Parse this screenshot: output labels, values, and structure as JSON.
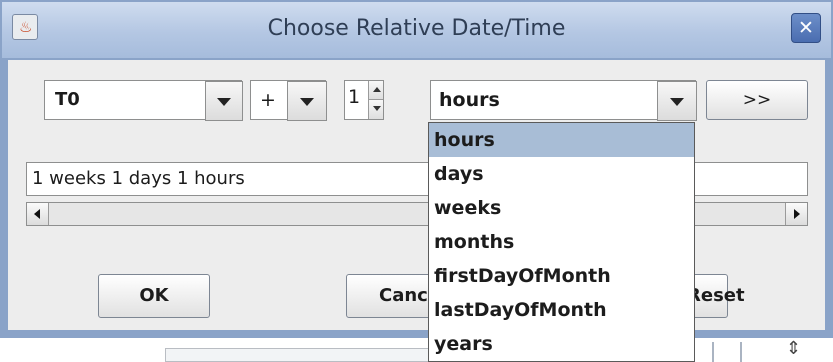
{
  "window": {
    "title": "Choose Relative Date/Time",
    "close_glyph": "✕",
    "app_icon": "java-cup-icon"
  },
  "row1": {
    "reference": "T0",
    "operator": "+",
    "amount": "1",
    "unit": "hours",
    "next_label": ">>"
  },
  "expression": {
    "value": "1 weeks 1 days 1 hours"
  },
  "buttons": {
    "ok": "OK",
    "cancel": "Cancel",
    "reset": "Reset"
  },
  "dropdown": {
    "options": [
      "hours",
      "days",
      "weeks",
      "months",
      "firstDayOfMonth",
      "lastDayOfMonth",
      "years"
    ],
    "selected": "hours"
  },
  "colors": {
    "title_bar": "#b4c7e3",
    "selection": "#a8bdd6",
    "close_button": "#4a6db0"
  }
}
